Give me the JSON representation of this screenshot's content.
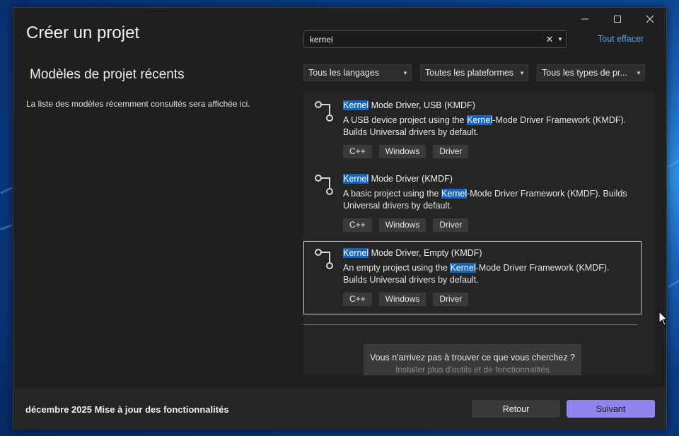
{
  "window": {
    "title": "Créer un projet",
    "controls": [
      "minimize-icon",
      "maximize-icon",
      "close-icon"
    ]
  },
  "recent": {
    "title": "Modèles de projet récents",
    "text": "La liste des modèles récemment consultés sera affichée ici."
  },
  "search": {
    "value": "kernel",
    "clear_all": "Tout effacer"
  },
  "filters": {
    "language": "Tous les langages",
    "platform": "Toutes les plateformes",
    "type": "Tous les types de pr..."
  },
  "templates": [
    {
      "name_highlight": "Kernel",
      "name_rest": " Mode Driver, USB (KMDF)",
      "desc_before": "A USB device project using the ",
      "desc_highlight": "Kernel",
      "desc_after": "-Mode Driver Framework (KMDF). Builds Universal drivers by default.",
      "tags": [
        "C++",
        "Windows",
        "Driver"
      ]
    },
    {
      "name_highlight": "Kernel",
      "name_rest": " Mode Driver (KMDF)",
      "desc_before": "A basic project using the ",
      "desc_highlight": "Kernel",
      "desc_after": "-Mode Driver Framework (KMDF). Builds Universal drivers by default.",
      "tags": [
        "C++",
        "Windows",
        "Driver"
      ]
    },
    {
      "name_highlight": "Kernel",
      "name_rest": " Mode Driver, Empty (KMDF)",
      "desc_before": "An empty project using the ",
      "desc_highlight": "Kernel",
      "desc_after": "-Mode Driver Framework (KMDF). Builds Universal drivers by default.",
      "tags": [
        "C++",
        "Windows",
        "Driver"
      ],
      "selected": true
    }
  ],
  "not_found": {
    "line1": "Vous n'arrivez pas à trouver ce que vous cherchez ?",
    "line2": "Installer plus d'outils et de fonctionnalités"
  },
  "footer": {
    "text": "décembre 2025 Mise à jour des fonctionnalités",
    "back": "Retour",
    "next": "Suivant"
  },
  "colors": {
    "accent": "#9184ee",
    "link": "#5aa7f0",
    "highlight": "#1565c0",
    "background": "#1f1f1f"
  }
}
